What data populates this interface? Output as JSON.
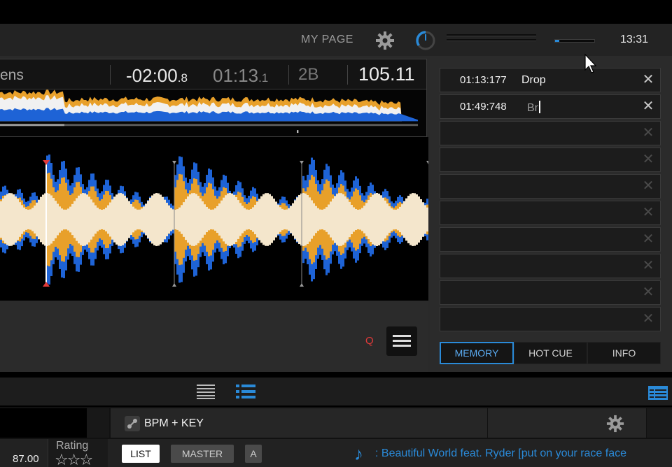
{
  "header": {
    "my_page": "MY PAGE",
    "clock": "13:31",
    "settings_icon": "gear-icon",
    "dial_icon": "dial-icon",
    "slider_level": 0.1
  },
  "deck": {
    "title_fragment": "ens",
    "remaining_main": "-02:00",
    "remaining_frac": ".8",
    "elapsed_main": "01:13",
    "elapsed_frac": ".1",
    "key": "2B",
    "bpm": "105.11",
    "quantize_label": "Q",
    "menu_icon": "hamburger-icon"
  },
  "memory_cues": [
    {
      "time": "01:13:177",
      "name": "Drop"
    },
    {
      "time": "01:49:748",
      "name": "Br",
      "editing": true
    },
    {
      "time": "",
      "name": ""
    },
    {
      "time": "",
      "name": ""
    },
    {
      "time": "",
      "name": ""
    },
    {
      "time": "",
      "name": ""
    },
    {
      "time": "",
      "name": ""
    },
    {
      "time": "",
      "name": ""
    },
    {
      "time": "",
      "name": ""
    },
    {
      "time": "",
      "name": ""
    }
  ],
  "panel_tabs": [
    {
      "label": "MEMORY",
      "active": true
    },
    {
      "label": "HOT CUE",
      "active": false
    },
    {
      "label": "INFO",
      "active": false
    }
  ],
  "browser": {
    "view_icons": [
      "list-view-icon",
      "detail-list-icon",
      "table-view-icon"
    ],
    "bpm_key_label": "BPM + KEY",
    "bpm_value": "87.00",
    "rating_label": "Rating",
    "list_button": "LIST",
    "master_button": "MASTER",
    "a_button": "A",
    "now_playing": ": Beautiful World feat. Ryder [put on your race face"
  },
  "colors": {
    "accent": "#2a8ad8",
    "wave_blue": "#1e63d6",
    "wave_orange": "#e8a02a",
    "wave_cream": "#f4e6cc",
    "cue_red": "#e23a3a"
  }
}
